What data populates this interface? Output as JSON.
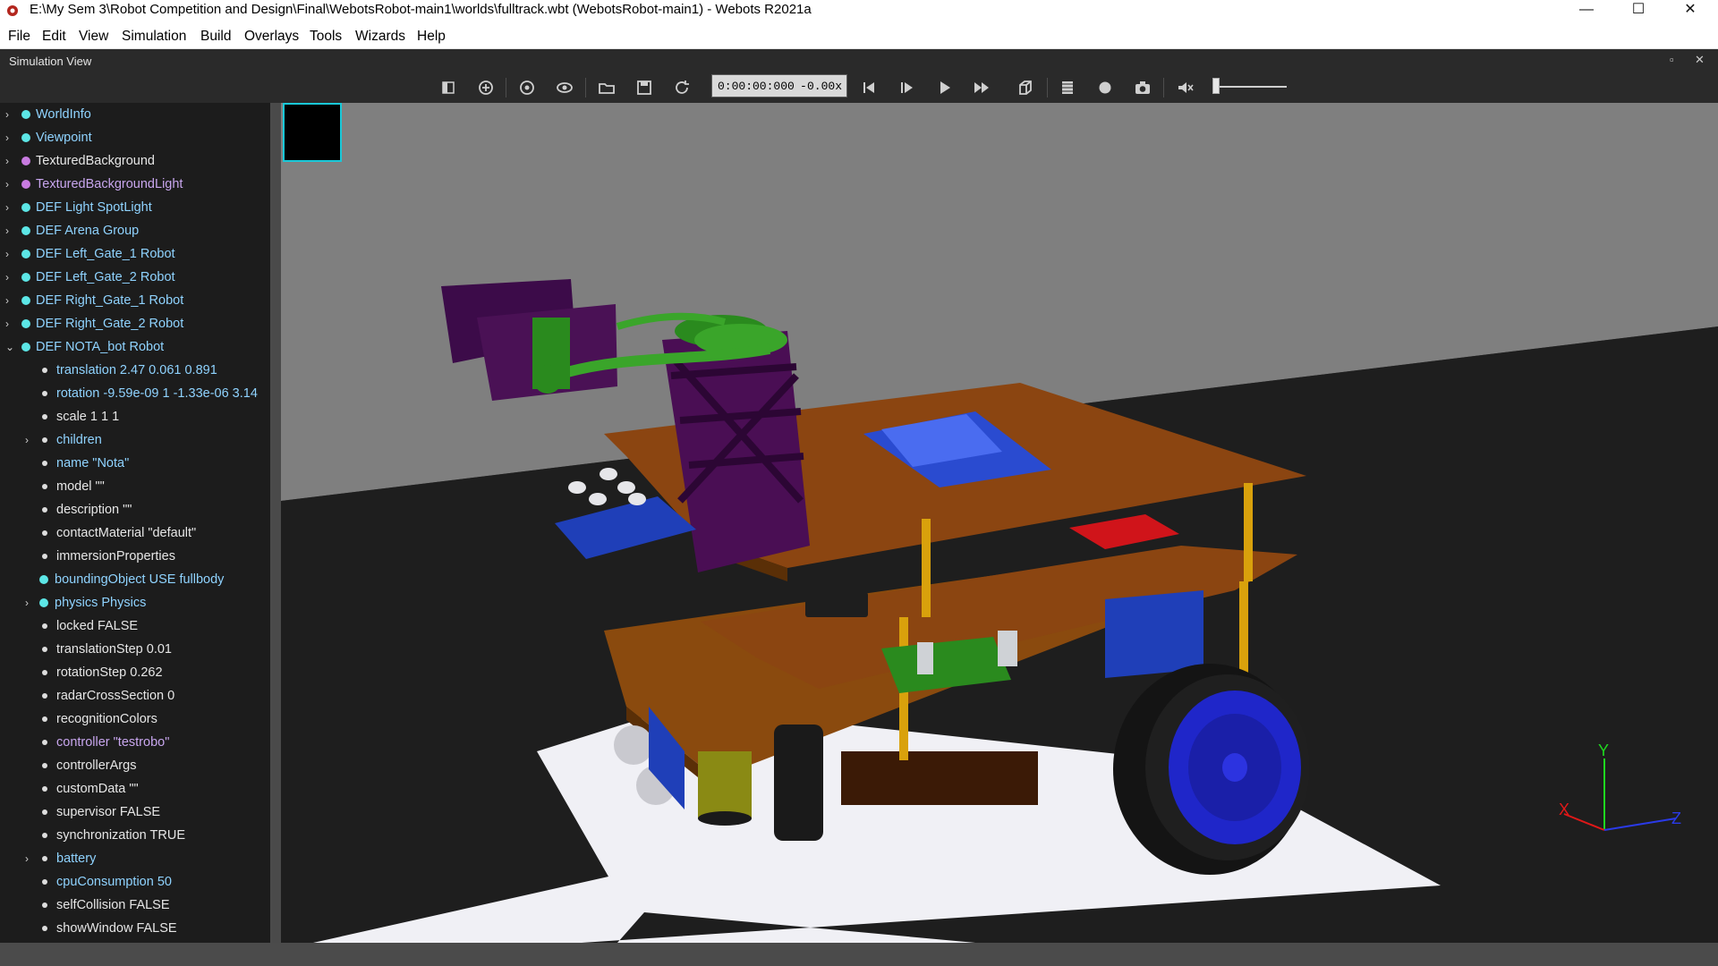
{
  "window": {
    "title": "E:\\My Sem 3\\Robot Competition and Design\\Final\\WebotsRobot-main1\\worlds\\fulltrack.wbt (WebotsRobot-main1) - Webots R2021a",
    "minimize": "—",
    "maximize": "☐",
    "close": "✕"
  },
  "menu": [
    "File",
    "Edit",
    "View",
    "Simulation",
    "Build",
    "Overlays",
    "Tools",
    "Wizards",
    "Help"
  ],
  "panel": {
    "title": "Simulation View",
    "float_btn": "▫",
    "close_btn": "✕"
  },
  "toolbar": {
    "time": "0:00:00:000",
    "separator": "-",
    "speed": "0.00x",
    "icons": [
      "hide-scene-tree-icon",
      "add-node-icon",
      "reset-viewpoint-icon",
      "change-view-icon",
      "open-world-icon",
      "save-world-icon",
      "reload-world-icon",
      "reset-simulation-icon",
      "step-icon",
      "play-icon",
      "fast-forward-icon",
      "rendering-icon",
      "record-movie-icon",
      "record-icon",
      "screenshot-icon",
      "mute-icon"
    ],
    "volume_level": 0.0
  },
  "colors": {
    "node_cyan": "#5ce6e6",
    "node_violet": "#c87be0",
    "field_white": "#dddddd",
    "text_light": "#e6e6e6",
    "text_violet": "#c8a6ee",
    "text_cyan": "#8fd3ff",
    "accent_cyan": "#19c8d8"
  },
  "scene_tree": [
    {
      "label": "WorldInfo",
      "color": "#8fd3ff",
      "dot": "#5ce6e6",
      "arrow": "›",
      "level": 0
    },
    {
      "label": "Viewpoint",
      "color": "#8fd3ff",
      "dot": "#5ce6e6",
      "arrow": "›",
      "level": 0
    },
    {
      "label": "TexturedBackground",
      "color": "#e6e6e6",
      "dot": "#c87be0",
      "arrow": "›",
      "level": 0
    },
    {
      "label": "TexturedBackgroundLight",
      "color": "#c8a6ee",
      "dot": "#c87be0",
      "arrow": "›",
      "level": 0
    },
    {
      "label": "DEF Light SpotLight",
      "color": "#8fd3ff",
      "dot": "#5ce6e6",
      "arrow": "›",
      "level": 0
    },
    {
      "label": "DEF Arena Group",
      "color": "#8fd3ff",
      "dot": "#5ce6e6",
      "arrow": "›",
      "level": 0
    },
    {
      "label": "DEF Left_Gate_1 Robot",
      "color": "#8fd3ff",
      "dot": "#5ce6e6",
      "arrow": "›",
      "level": 0
    },
    {
      "label": "DEF Left_Gate_2 Robot",
      "color": "#8fd3ff",
      "dot": "#5ce6e6",
      "arrow": "›",
      "level": 0
    },
    {
      "label": "DEF Right_Gate_1 Robot",
      "color": "#8fd3ff",
      "dot": "#5ce6e6",
      "arrow": "›",
      "level": 0
    },
    {
      "label": "DEF Right_Gate_2 Robot",
      "color": "#8fd3ff",
      "dot": "#5ce6e6",
      "arrow": "›",
      "level": 0
    },
    {
      "label": "DEF NOTA_bot Robot",
      "color": "#8fd3ff",
      "dot": "#5ce6e6",
      "arrow": "⌄",
      "level": 0
    },
    {
      "label": "translation 2.47 0.061 0.891",
      "color": "#8fd3ff",
      "dot": "#dddddd",
      "arrow": "",
      "level": 1,
      "small": true
    },
    {
      "label": "rotation -9.59e-09 1 -1.33e-06 3.14",
      "color": "#8fd3ff",
      "dot": "#dddddd",
      "arrow": "",
      "level": 1,
      "small": true
    },
    {
      "label": "scale 1 1 1",
      "color": "#e6e6e6",
      "dot": "#dddddd",
      "arrow": "",
      "level": 1,
      "small": true
    },
    {
      "label": "children",
      "color": "#8fd3ff",
      "dot": "#dddddd",
      "arrow": "›",
      "level": 1,
      "small": true
    },
    {
      "label": "name \"Nota\"",
      "color": "#8fd3ff",
      "dot": "#dddddd",
      "arrow": "",
      "level": 1,
      "small": true
    },
    {
      "label": "model \"\"",
      "color": "#e6e6e6",
      "dot": "#dddddd",
      "arrow": "",
      "level": 1,
      "small": true
    },
    {
      "label": "description \"\"",
      "color": "#e6e6e6",
      "dot": "#dddddd",
      "arrow": "",
      "level": 1,
      "small": true
    },
    {
      "label": "contactMaterial \"default\"",
      "color": "#e6e6e6",
      "dot": "#dddddd",
      "arrow": "",
      "level": 1,
      "small": true
    },
    {
      "label": "immersionProperties",
      "color": "#e6e6e6",
      "dot": "#dddddd",
      "arrow": "",
      "level": 1,
      "small": true
    },
    {
      "label": "boundingObject USE fullbody",
      "color": "#8fd3ff",
      "dot": "#5ce6e6",
      "arrow": "",
      "level": 1
    },
    {
      "label": "physics Physics",
      "color": "#8fd3ff",
      "dot": "#5ce6e6",
      "arrow": "›",
      "level": 1
    },
    {
      "label": "locked FALSE",
      "color": "#e6e6e6",
      "dot": "#dddddd",
      "arrow": "",
      "level": 1,
      "small": true
    },
    {
      "label": "translationStep 0.01",
      "color": "#e6e6e6",
      "dot": "#dddddd",
      "arrow": "",
      "level": 1,
      "small": true
    },
    {
      "label": "rotationStep 0.262",
      "color": "#e6e6e6",
      "dot": "#dddddd",
      "arrow": "",
      "level": 1,
      "small": true
    },
    {
      "label": "radarCrossSection 0",
      "color": "#e6e6e6",
      "dot": "#dddddd",
      "arrow": "",
      "level": 1,
      "small": true
    },
    {
      "label": "recognitionColors",
      "color": "#e6e6e6",
      "dot": "#dddddd",
      "arrow": "",
      "level": 1,
      "small": true
    },
    {
      "label": "controller \"testrobo\"",
      "color": "#c8a6ee",
      "dot": "#dddddd",
      "arrow": "",
      "level": 1,
      "small": true
    },
    {
      "label": "controllerArgs",
      "color": "#e6e6e6",
      "dot": "#dddddd",
      "arrow": "",
      "level": 1,
      "small": true
    },
    {
      "label": "customData \"\"",
      "color": "#e6e6e6",
      "dot": "#dddddd",
      "arrow": "",
      "level": 1,
      "small": true
    },
    {
      "label": "supervisor FALSE",
      "color": "#e6e6e6",
      "dot": "#dddddd",
      "arrow": "",
      "level": 1,
      "small": true
    },
    {
      "label": "synchronization TRUE",
      "color": "#e6e6e6",
      "dot": "#dddddd",
      "arrow": "",
      "level": 1,
      "small": true
    },
    {
      "label": "battery",
      "color": "#8fd3ff",
      "dot": "#dddddd",
      "arrow": "›",
      "level": 1,
      "small": true
    },
    {
      "label": "cpuConsumption 50",
      "color": "#8fd3ff",
      "dot": "#dddddd",
      "arrow": "",
      "level": 1,
      "small": true
    },
    {
      "label": "selfCollision FALSE",
      "color": "#e6e6e6",
      "dot": "#dddddd",
      "arrow": "",
      "level": 1,
      "small": true
    },
    {
      "label": "showWindow FALSE",
      "color": "#e6e6e6",
      "dot": "#dddddd",
      "arrow": "",
      "level": 1,
      "small": true
    }
  ],
  "viewport": {
    "axis_labels": {
      "x": "X",
      "y": "Y",
      "z": "Z"
    }
  }
}
